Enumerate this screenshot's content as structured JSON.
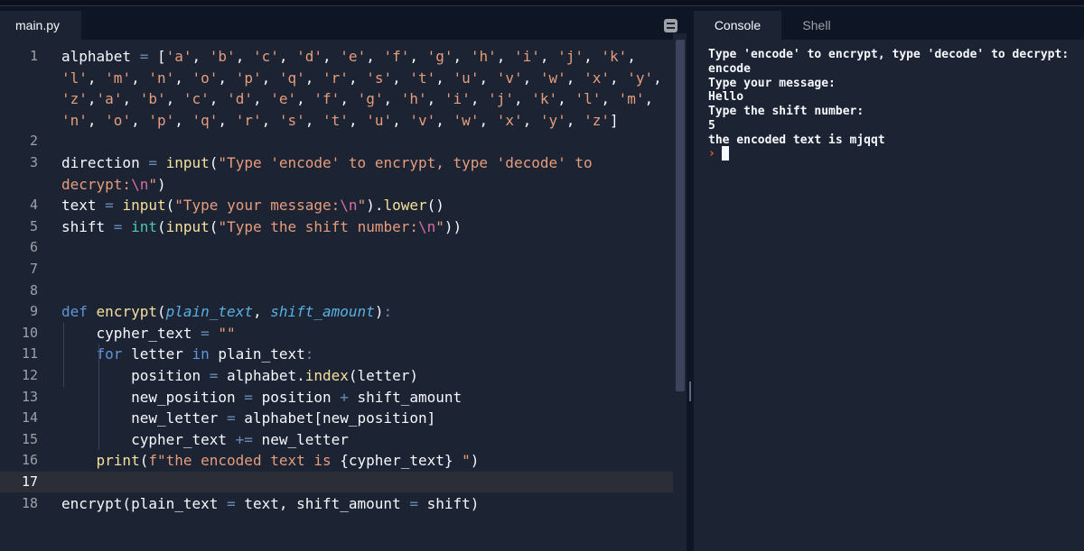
{
  "editor": {
    "file_tab": "main.py",
    "lines": [
      {
        "n": "1",
        "t": [
          [
            "alphabet ",
            ""
          ],
          [
            "=",
            " o"
          ],
          [
            " [",
            ""
          ],
          [
            "'a'",
            "s"
          ],
          [
            ", ",
            ""
          ],
          [
            "'b'",
            "s"
          ],
          [
            ", ",
            ""
          ],
          [
            "'c'",
            "s"
          ],
          [
            ", ",
            ""
          ],
          [
            "'d'",
            "s"
          ],
          [
            ", ",
            ""
          ],
          [
            "'e'",
            "s"
          ],
          [
            ", ",
            ""
          ],
          [
            "'f'",
            "s"
          ],
          [
            ", ",
            ""
          ],
          [
            "'g'",
            "s"
          ],
          [
            ", ",
            ""
          ],
          [
            "'h'",
            "s"
          ],
          [
            ", ",
            ""
          ],
          [
            "'i'",
            "s"
          ],
          [
            ", ",
            ""
          ],
          [
            "'j'",
            "s"
          ],
          [
            ", ",
            ""
          ],
          [
            "'k'",
            "s"
          ],
          [
            ",",
            ""
          ]
        ]
      },
      {
        "n": "",
        "t": [
          [
            "'l'",
            "s"
          ],
          [
            ", ",
            ""
          ],
          [
            "'m'",
            "s"
          ],
          [
            ", ",
            ""
          ],
          [
            "'n'",
            "s"
          ],
          [
            ", ",
            ""
          ],
          [
            "'o'",
            "s"
          ],
          [
            ", ",
            ""
          ],
          [
            "'p'",
            "s"
          ],
          [
            ", ",
            ""
          ],
          [
            "'q'",
            "s"
          ],
          [
            ", ",
            ""
          ],
          [
            "'r'",
            "s"
          ],
          [
            ", ",
            ""
          ],
          [
            "'s'",
            "s"
          ],
          [
            ", ",
            ""
          ],
          [
            "'t'",
            "s"
          ],
          [
            ", ",
            ""
          ],
          [
            "'u'",
            "s"
          ],
          [
            ", ",
            ""
          ],
          [
            "'v'",
            "s"
          ],
          [
            ", ",
            ""
          ],
          [
            "'w'",
            "s"
          ],
          [
            ", ",
            ""
          ],
          [
            "'x'",
            "s"
          ],
          [
            ", ",
            ""
          ],
          [
            "'y'",
            "s"
          ],
          [
            ",",
            ""
          ]
        ]
      },
      {
        "n": "",
        "t": [
          [
            "'z'",
            "s"
          ],
          [
            ",",
            ""
          ],
          [
            "'a'",
            "s"
          ],
          [
            ", ",
            ""
          ],
          [
            "'b'",
            "s"
          ],
          [
            ", ",
            ""
          ],
          [
            "'c'",
            "s"
          ],
          [
            ", ",
            ""
          ],
          [
            "'d'",
            "s"
          ],
          [
            ", ",
            ""
          ],
          [
            "'e'",
            "s"
          ],
          [
            ", ",
            ""
          ],
          [
            "'f'",
            "s"
          ],
          [
            ", ",
            ""
          ],
          [
            "'g'",
            "s"
          ],
          [
            ", ",
            ""
          ],
          [
            "'h'",
            "s"
          ],
          [
            ", ",
            ""
          ],
          [
            "'i'",
            "s"
          ],
          [
            ", ",
            ""
          ],
          [
            "'j'",
            "s"
          ],
          [
            ", ",
            ""
          ],
          [
            "'k'",
            "s"
          ],
          [
            ", ",
            ""
          ],
          [
            "'l'",
            "s"
          ],
          [
            ", ",
            ""
          ],
          [
            "'m'",
            "s"
          ],
          [
            ",",
            ""
          ]
        ]
      },
      {
        "n": "",
        "t": [
          [
            "'n'",
            "s"
          ],
          [
            ", ",
            ""
          ],
          [
            "'o'",
            "s"
          ],
          [
            ", ",
            ""
          ],
          [
            "'p'",
            "s"
          ],
          [
            ", ",
            ""
          ],
          [
            "'q'",
            "s"
          ],
          [
            ", ",
            ""
          ],
          [
            "'r'",
            "s"
          ],
          [
            ", ",
            ""
          ],
          [
            "'s'",
            "s"
          ],
          [
            ", ",
            ""
          ],
          [
            "'t'",
            "s"
          ],
          [
            ", ",
            ""
          ],
          [
            "'u'",
            "s"
          ],
          [
            ", ",
            ""
          ],
          [
            "'v'",
            "s"
          ],
          [
            ", ",
            ""
          ],
          [
            "'w'",
            "s"
          ],
          [
            ", ",
            ""
          ],
          [
            "'x'",
            "s"
          ],
          [
            ", ",
            ""
          ],
          [
            "'y'",
            "s"
          ],
          [
            ", ",
            ""
          ],
          [
            "'z'",
            "s"
          ],
          [
            "]",
            ""
          ]
        ]
      },
      {
        "n": "2",
        "t": []
      },
      {
        "n": "3",
        "t": [
          [
            "direction ",
            ""
          ],
          [
            "=",
            "o"
          ],
          [
            " ",
            ""
          ],
          [
            "input",
            "f"
          ],
          [
            "(",
            ""
          ],
          [
            "\"Type 'encode' to encrypt, type 'decode' to",
            "s"
          ]
        ]
      },
      {
        "n": "",
        "t": [
          [
            "decrypt:",
            "s"
          ],
          [
            "\\n",
            "e"
          ],
          [
            "\"",
            "s"
          ],
          [
            ")",
            ""
          ]
        ]
      },
      {
        "n": "4",
        "t": [
          [
            "text ",
            ""
          ],
          [
            "=",
            "o"
          ],
          [
            " ",
            ""
          ],
          [
            "input",
            "f"
          ],
          [
            "(",
            ""
          ],
          [
            "\"Type your message:",
            "s"
          ],
          [
            "\\n",
            "e"
          ],
          [
            "\"",
            "s"
          ],
          [
            ").",
            ""
          ],
          [
            "lower",
            "f"
          ],
          [
            "()",
            ""
          ]
        ]
      },
      {
        "n": "5",
        "t": [
          [
            "shift ",
            ""
          ],
          [
            "=",
            "o"
          ],
          [
            " ",
            ""
          ],
          [
            "int",
            "b"
          ],
          [
            "(",
            ""
          ],
          [
            "input",
            "f"
          ],
          [
            "(",
            ""
          ],
          [
            "\"Type the shift number:",
            "s"
          ],
          [
            "\\n",
            "e"
          ],
          [
            "\"",
            "s"
          ],
          [
            "))",
            ""
          ]
        ]
      },
      {
        "n": "6",
        "t": []
      },
      {
        "n": "7",
        "t": []
      },
      {
        "n": "8",
        "t": []
      },
      {
        "n": "9",
        "t": [
          [
            "def",
            "k"
          ],
          [
            " ",
            ""
          ],
          [
            "encrypt",
            "f"
          ],
          [
            "(",
            ""
          ],
          [
            "plain_text",
            "p"
          ],
          [
            ", ",
            ""
          ],
          [
            "shift_amount",
            "p"
          ],
          [
            ")",
            ""
          ],
          [
            ":",
            "o"
          ]
        ]
      },
      {
        "n": "10",
        "t": [
          [
            "    cypher_text ",
            ""
          ],
          [
            "=",
            "o"
          ],
          [
            " ",
            ""
          ],
          [
            "\"\"",
            "s"
          ]
        ]
      },
      {
        "n": "11",
        "t": [
          [
            "    ",
            ""
          ],
          [
            "for",
            "k"
          ],
          [
            " letter ",
            ""
          ],
          [
            "in",
            "k"
          ],
          [
            " plain_text",
            ""
          ],
          [
            ":",
            "o"
          ]
        ]
      },
      {
        "n": "12",
        "t": [
          [
            "        position ",
            ""
          ],
          [
            "=",
            "o"
          ],
          [
            " alphabet.",
            ""
          ],
          [
            "index",
            "f"
          ],
          [
            "(letter)",
            ""
          ]
        ]
      },
      {
        "n": "13",
        "t": [
          [
            "        new_position ",
            ""
          ],
          [
            "=",
            "o"
          ],
          [
            " position ",
            ""
          ],
          [
            "+",
            "o"
          ],
          [
            " shift_amount",
            ""
          ]
        ]
      },
      {
        "n": "14",
        "t": [
          [
            "        new_letter ",
            ""
          ],
          [
            "=",
            "o"
          ],
          [
            " alphabet[new_position]",
            ""
          ]
        ]
      },
      {
        "n": "15",
        "t": [
          [
            "        cypher_text ",
            ""
          ],
          [
            "+=",
            "o"
          ],
          [
            " new_letter",
            ""
          ]
        ]
      },
      {
        "n": "16",
        "t": [
          [
            "    ",
            ""
          ],
          [
            "print",
            "f"
          ],
          [
            "(",
            ""
          ],
          [
            "f\"the encoded text is ",
            "s"
          ],
          [
            "{cypher_text}",
            ""
          ],
          [
            " \"",
            "s"
          ],
          [
            ")",
            ""
          ]
        ]
      },
      {
        "n": "17",
        "t": [],
        "active": true
      },
      {
        "n": "18",
        "t": [
          [
            "encrypt(plain_text ",
            ""
          ],
          [
            "=",
            "o"
          ],
          [
            " text, shift_amount ",
            ""
          ],
          [
            "=",
            "o"
          ],
          [
            " shift)",
            ""
          ]
        ]
      }
    ]
  },
  "console": {
    "tabs": [
      "Console",
      "Shell"
    ],
    "output": "Type 'encode' to encrypt, type 'decode' to decrypt:\nencode\nType your message:\nHello\nType the shift number:\n5\nthe encoded text is mjqqt",
    "prompt_symbol": "›"
  },
  "icons": {
    "panel_toggle": "panel-menu-icon",
    "prompt": "console-prompt-icon"
  }
}
